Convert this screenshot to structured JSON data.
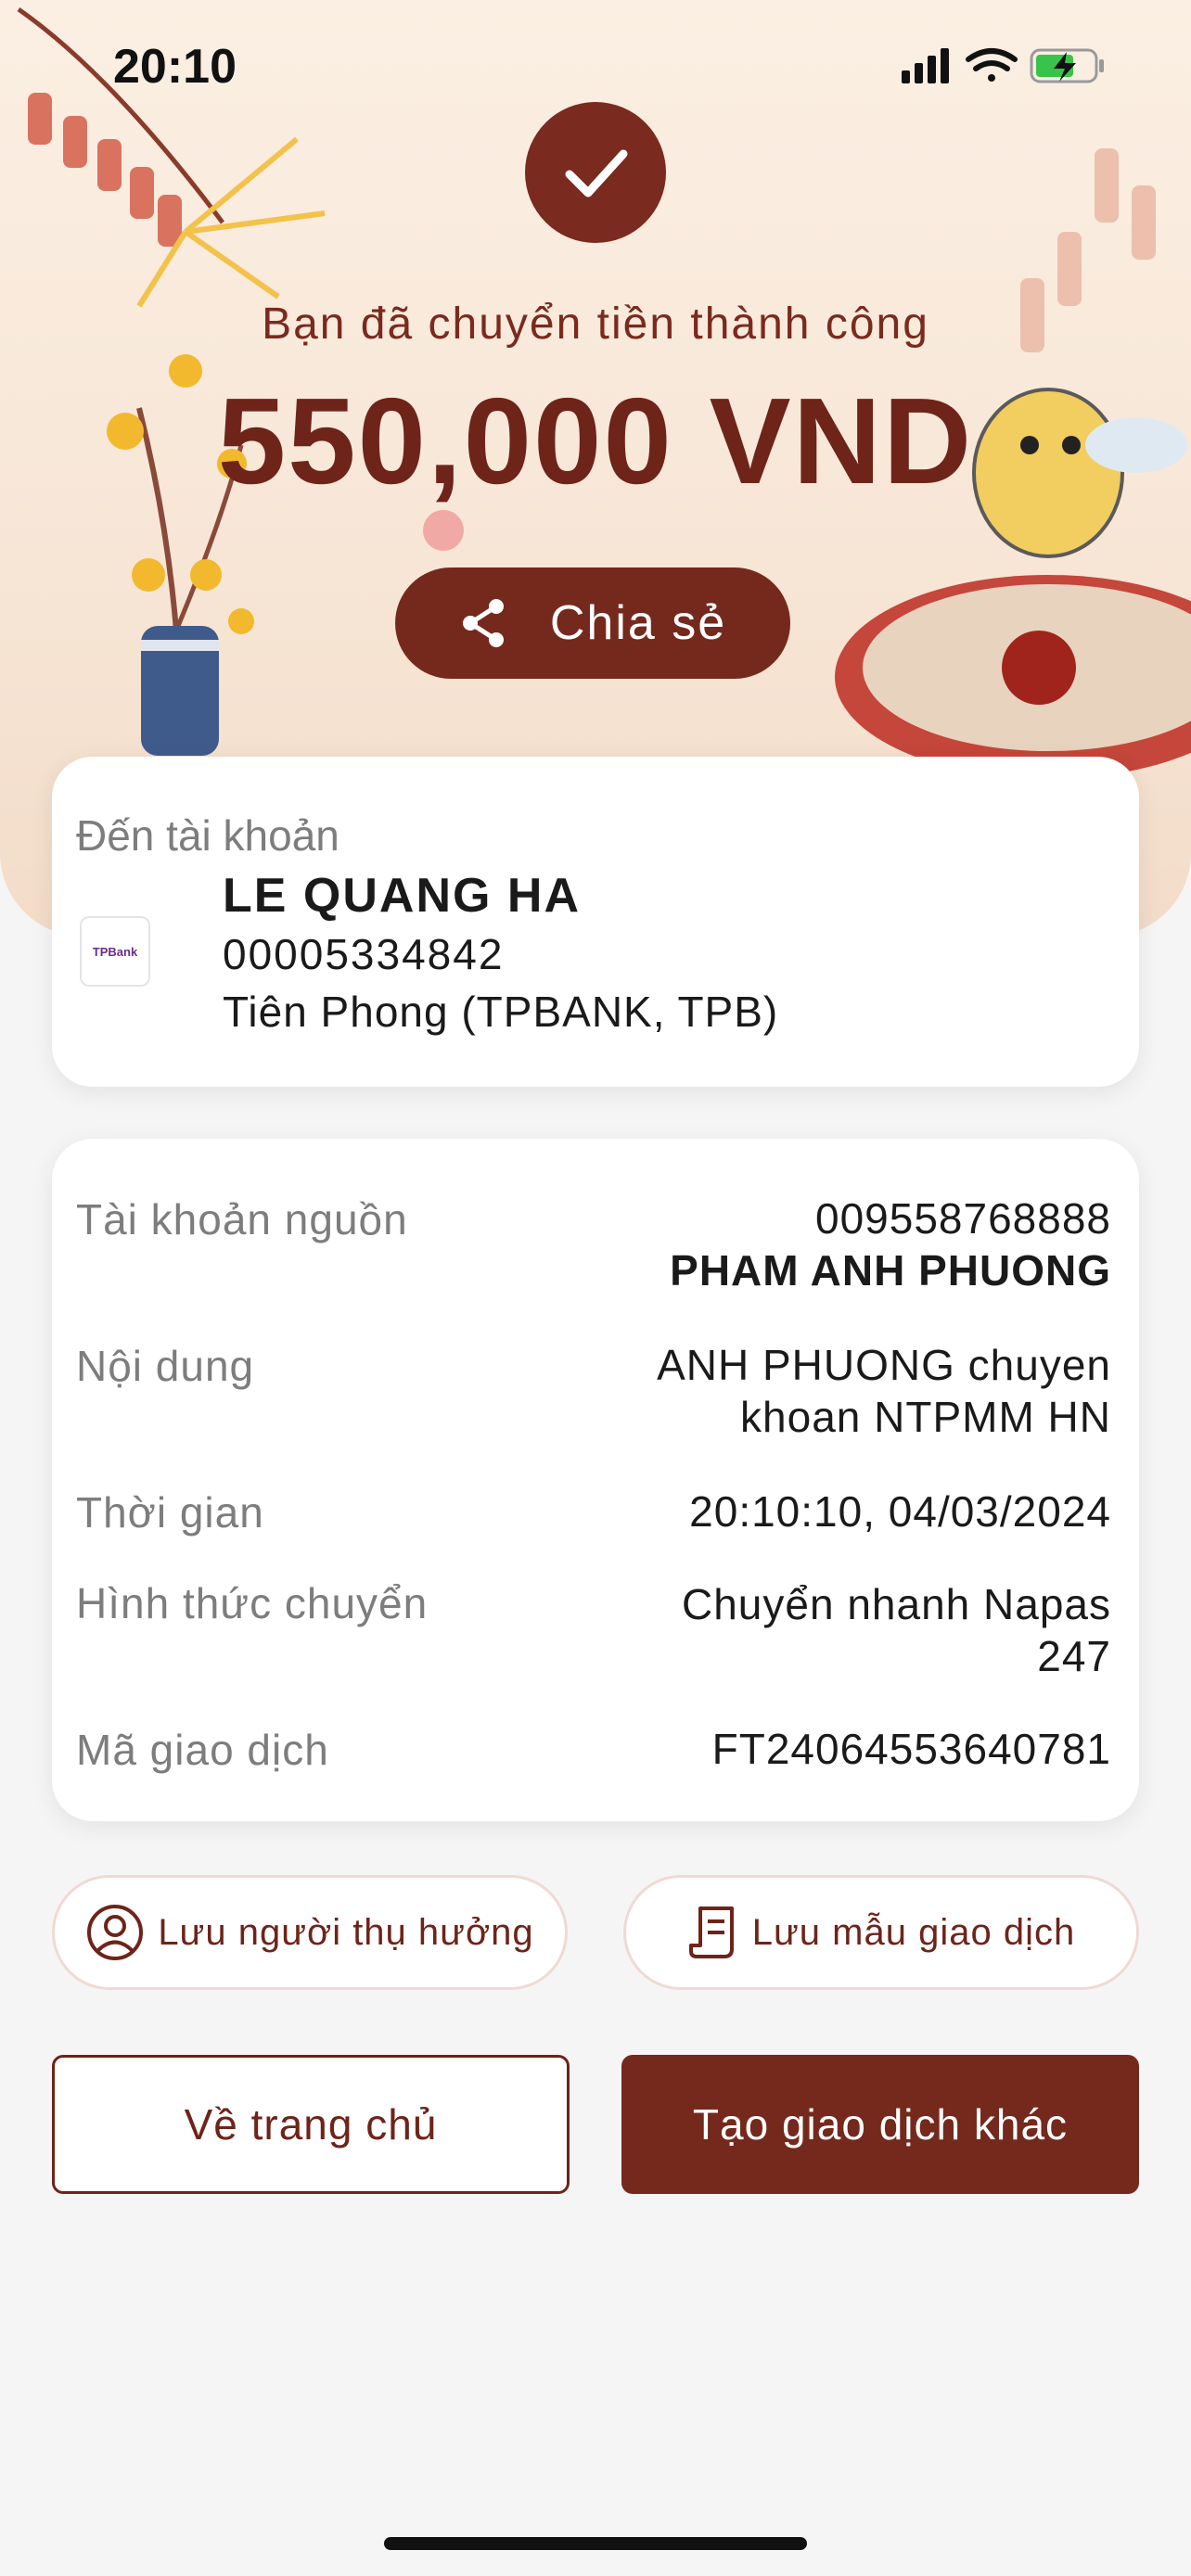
{
  "status_bar": {
    "time": "20:10"
  },
  "hero": {
    "success_text": "Bạn đã chuyển tiền thành công",
    "amount": "550,000 VND",
    "share_label": "Chia sẻ"
  },
  "destination": {
    "label": "Đến tài khoản",
    "bank_logo_text": "TPBank",
    "name": "LE QUANG HA",
    "account": "00005334842",
    "bank": "Tiên Phong (TPBANK, TPB)"
  },
  "details": {
    "source_label": "Tài khoản nguồn",
    "source_account": "009558768888",
    "source_name": "PHAM ANH PHUONG",
    "content_label": "Nội dung",
    "content_line1": "ANH PHUONG chuyen",
    "content_line2": "khoan NTPMM HN",
    "time_label": "Thời gian",
    "time_value": "20:10:10, 04/03/2024",
    "method_label": "Hình thức chuyển",
    "method_line1": "Chuyển nhanh Napas",
    "method_line2": "247",
    "txn_label": "Mã giao dịch",
    "txn_value": "FT24064553640781"
  },
  "actions": {
    "save_beneficiary": "Lưu người thụ hưởng",
    "save_template": "Lưu mẫu giao dịch",
    "home": "Về trang chủ",
    "new_transaction": "Tạo giao dịch khác"
  },
  "colors": {
    "brand": "#74291c",
    "hero_bg": "#fbefe3",
    "page_bg": "#f6f5f5"
  },
  "icons": [
    "checkmark-icon",
    "share-icon",
    "user-circle-icon",
    "receipt-icon",
    "signal-icon",
    "wifi-icon",
    "battery-icon"
  ]
}
